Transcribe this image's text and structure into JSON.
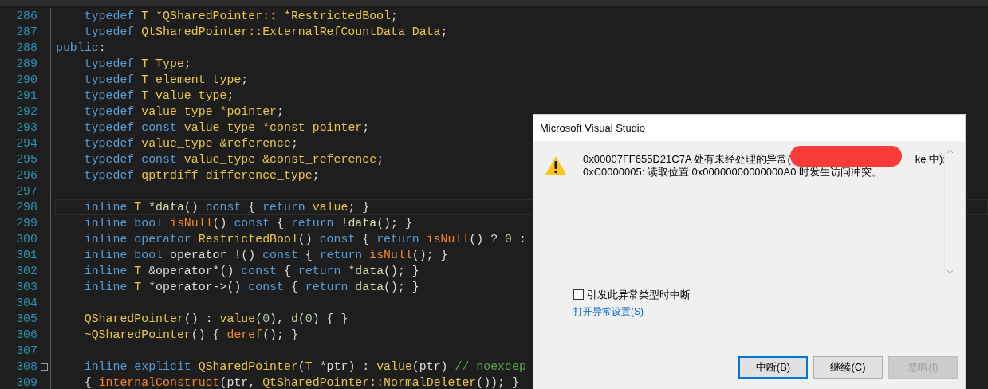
{
  "editor": {
    "lines": [
      {
        "number": "286",
        "current": false,
        "fold": false,
        "tokens": [
          {
            "kind": "kw",
            "t": "    typedef "
          },
          {
            "kind": "ty",
            "t": "T *QSharedPointer:: *RestrictedBool"
          },
          {
            "kind": "pl",
            "t": ";"
          }
        ]
      },
      {
        "number": "287",
        "current": false,
        "fold": false,
        "tokens": [
          {
            "kind": "kw",
            "t": "    typedef "
          },
          {
            "kind": "ty",
            "t": "QtSharedPointer::ExternalRefCountData Data"
          },
          {
            "kind": "pl",
            "t": ";"
          }
        ]
      },
      {
        "number": "288",
        "current": false,
        "fold": false,
        "tokens": [
          {
            "kind": "kw",
            "t": "public"
          },
          {
            "kind": "pl",
            "t": ":"
          }
        ]
      },
      {
        "number": "289",
        "current": false,
        "fold": false,
        "tokens": [
          {
            "kind": "kw",
            "t": "    typedef "
          },
          {
            "kind": "ty",
            "t": "T Type"
          },
          {
            "kind": "pl",
            "t": ";"
          }
        ]
      },
      {
        "number": "290",
        "current": false,
        "fold": false,
        "tokens": [
          {
            "kind": "kw",
            "t": "    typedef "
          },
          {
            "kind": "ty",
            "t": "T element_type"
          },
          {
            "kind": "pl",
            "t": ";"
          }
        ]
      },
      {
        "number": "291",
        "current": false,
        "fold": false,
        "tokens": [
          {
            "kind": "kw",
            "t": "    typedef "
          },
          {
            "kind": "ty",
            "t": "T value_type"
          },
          {
            "kind": "pl",
            "t": ";"
          }
        ]
      },
      {
        "number": "292",
        "current": false,
        "fold": false,
        "tokens": [
          {
            "kind": "kw",
            "t": "    typedef "
          },
          {
            "kind": "ty",
            "t": "value_type *pointer"
          },
          {
            "kind": "pl",
            "t": ";"
          }
        ]
      },
      {
        "number": "293",
        "current": false,
        "fold": false,
        "tokens": [
          {
            "kind": "kw",
            "t": "    typedef const "
          },
          {
            "kind": "ty",
            "t": "value_type *const_pointer"
          },
          {
            "kind": "pl",
            "t": ";"
          }
        ]
      },
      {
        "number": "294",
        "current": false,
        "fold": false,
        "tokens": [
          {
            "kind": "kw",
            "t": "    typedef "
          },
          {
            "kind": "ty",
            "t": "value_type &reference"
          },
          {
            "kind": "pl",
            "t": ";"
          }
        ]
      },
      {
        "number": "295",
        "current": false,
        "fold": false,
        "tokens": [
          {
            "kind": "kw",
            "t": "    typedef const "
          },
          {
            "kind": "ty",
            "t": "value_type &const_reference"
          },
          {
            "kind": "pl",
            "t": ";"
          }
        ]
      },
      {
        "number": "296",
        "current": false,
        "fold": false,
        "tokens": [
          {
            "kind": "kw",
            "t": "    typedef "
          },
          {
            "kind": "ty",
            "t": "qptrdiff difference_type"
          },
          {
            "kind": "pl",
            "t": ";"
          }
        ]
      },
      {
        "number": "297",
        "current": false,
        "fold": false
      },
      {
        "number": "298",
        "current": true,
        "fold": false,
        "tokens": [
          {
            "kind": "kw",
            "t": "    inline "
          },
          {
            "kind": "ty",
            "t": "T "
          },
          {
            "kind": "pl",
            "t": "*"
          },
          {
            "kind": "mb",
            "t": "data"
          },
          {
            "kind": "pl",
            "t": "() "
          },
          {
            "kind": "kw",
            "t": "const "
          },
          {
            "kind": "pl",
            "t": "{ "
          },
          {
            "kind": "kw",
            "t": "return "
          },
          {
            "kind": "ty",
            "t": "value"
          },
          {
            "kind": "pl",
            "t": "; }"
          }
        ]
      },
      {
        "number": "299",
        "current": false,
        "fold": false,
        "tokens": [
          {
            "kind": "kw",
            "t": "    inline bool "
          },
          {
            "kind": "fn",
            "t": "isNull"
          },
          {
            "kind": "pl",
            "t": "() "
          },
          {
            "kind": "kw",
            "t": "const "
          },
          {
            "kind": "pl",
            "t": "{ "
          },
          {
            "kind": "kw",
            "t": "return "
          },
          {
            "kind": "pl",
            "t": "!"
          },
          {
            "kind": "mb",
            "t": "data"
          },
          {
            "kind": "pl",
            "t": "(); }"
          }
        ]
      },
      {
        "number": "300",
        "current": false,
        "fold": false,
        "tokens": [
          {
            "kind": "kw",
            "t": "    inline operator "
          },
          {
            "kind": "ty",
            "t": "RestrictedBool"
          },
          {
            "kind": "pl",
            "t": "() "
          },
          {
            "kind": "kw",
            "t": "const "
          },
          {
            "kind": "pl",
            "t": "{ "
          },
          {
            "kind": "kw",
            "t": "return "
          },
          {
            "kind": "fn",
            "t": "isNull"
          },
          {
            "kind": "pl",
            "t": "() ? "
          },
          {
            "kind": "nm",
            "t": "0"
          },
          {
            "kind": "pl",
            "t": " :"
          }
        ]
      },
      {
        "number": "301",
        "current": false,
        "fold": false,
        "tokens": [
          {
            "kind": "kw",
            "t": "    inline bool "
          },
          {
            "kind": "pl",
            "t": "operator !() "
          },
          {
            "kind": "kw",
            "t": "const "
          },
          {
            "kind": "pl",
            "t": "{ "
          },
          {
            "kind": "kw",
            "t": "return "
          },
          {
            "kind": "fn",
            "t": "isNull"
          },
          {
            "kind": "pl",
            "t": "(); }"
          }
        ]
      },
      {
        "number": "302",
        "current": false,
        "fold": false,
        "tokens": [
          {
            "kind": "kw",
            "t": "    inline "
          },
          {
            "kind": "ty",
            "t": "T "
          },
          {
            "kind": "pl",
            "t": "&operator*() "
          },
          {
            "kind": "kw",
            "t": "const "
          },
          {
            "kind": "pl",
            "t": "{ "
          },
          {
            "kind": "kw",
            "t": "return "
          },
          {
            "kind": "pl",
            "t": "*"
          },
          {
            "kind": "mb",
            "t": "data"
          },
          {
            "kind": "pl",
            "t": "(); }"
          }
        ]
      },
      {
        "number": "303",
        "current": false,
        "fold": false,
        "tokens": [
          {
            "kind": "kw",
            "t": "    inline "
          },
          {
            "kind": "ty",
            "t": "T "
          },
          {
            "kind": "pl",
            "t": "*operator->() "
          },
          {
            "kind": "kw",
            "t": "const "
          },
          {
            "kind": "pl",
            "t": "{ "
          },
          {
            "kind": "kw",
            "t": "return "
          },
          {
            "kind": "mb",
            "t": "data"
          },
          {
            "kind": "pl",
            "t": "(); }"
          }
        ]
      },
      {
        "number": "304",
        "current": false,
        "fold": false
      },
      {
        "number": "305",
        "current": false,
        "fold": false,
        "tokens": [
          {
            "kind": "ty",
            "t": "    QSharedPointer"
          },
          {
            "kind": "pl",
            "t": "() : "
          },
          {
            "kind": "ty",
            "t": "value"
          },
          {
            "kind": "pl",
            "t": "("
          },
          {
            "kind": "nm",
            "t": "0"
          },
          {
            "kind": "pl",
            "t": "), "
          },
          {
            "kind": "mb",
            "t": "d"
          },
          {
            "kind": "pl",
            "t": "("
          },
          {
            "kind": "nm",
            "t": "0"
          },
          {
            "kind": "pl",
            "t": ") { }"
          }
        ]
      },
      {
        "number": "306",
        "current": false,
        "fold": false,
        "tokens": [
          {
            "kind": "ty",
            "t": "    ~QSharedPointer"
          },
          {
            "kind": "pl",
            "t": "() { "
          },
          {
            "kind": "fn",
            "t": "deref"
          },
          {
            "kind": "pl",
            "t": "(); }"
          }
        ]
      },
      {
        "number": "307",
        "current": false,
        "fold": false
      },
      {
        "number": "308",
        "current": false,
        "fold": true,
        "tokens": [
          {
            "kind": "kw",
            "t": "    inline explicit "
          },
          {
            "kind": "ty",
            "t": "QSharedPointer"
          },
          {
            "kind": "pl",
            "t": "("
          },
          {
            "kind": "ty",
            "t": "T "
          },
          {
            "kind": "pl",
            "t": "*ptr) : "
          },
          {
            "kind": "ty",
            "t": "value"
          },
          {
            "kind": "pl",
            "t": "(ptr) "
          },
          {
            "kind": "cm",
            "t": "// noexcep"
          }
        ]
      },
      {
        "number": "309",
        "current": false,
        "fold": false,
        "tokens": [
          {
            "kind": "pl",
            "t": "    { "
          },
          {
            "kind": "fn",
            "t": "internalConstruct"
          },
          {
            "kind": "pl",
            "t": "(ptr, "
          },
          {
            "kind": "ty",
            "t": "QtSharedPointer::NormalDeleter"
          },
          {
            "kind": "pl",
            "t": "()); }"
          }
        ]
      }
    ]
  },
  "dialog": {
    "title": "Microsoft Visual Studio",
    "message_start": "0x00007FF655D21C7A 处有未经处理的异常(",
    "message_end": "ke 中):",
    "message_line2": "0xC0000005: 读取位置 0x00000000000000A0 时发生访问冲突。",
    "checkbox": {
      "label": "引发此异常类型时中断",
      "checked": false
    },
    "link": "打开异常设置(S)",
    "buttons": [
      {
        "label": "中断(B)",
        "focused": true,
        "disabled": false
      },
      {
        "label": "继续(C)",
        "focused": false,
        "disabled": false
      },
      {
        "label": "忽略(I)",
        "focused": false,
        "disabled": true
      }
    ]
  }
}
